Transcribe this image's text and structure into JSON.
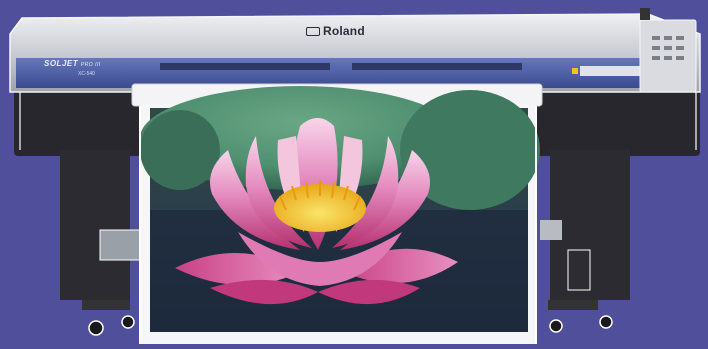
{
  "printer": {
    "brand": "Roland",
    "model": "SOLJET",
    "model_suffix": "PRO III",
    "model_sub": "XC-540"
  },
  "colors": {
    "background": "#4f4f9c",
    "body_silver": "#c9ccd2",
    "front_panel_blue": "#4e5fa6",
    "lower_body": "#2a2a30",
    "lotus_pink": "#e58cc0",
    "lotus_center": "#f6c92b",
    "lily_pad_green": "#4f9070",
    "water_dark": "#1e2c3e"
  },
  "icons": {
    "control_panel": "keypad-panel-icon",
    "brand_logo": "roland-logo-icon"
  }
}
